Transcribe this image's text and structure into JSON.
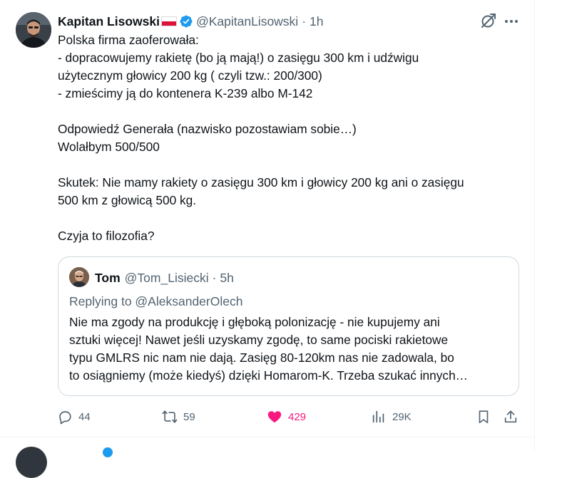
{
  "tweet": {
    "author_name": "Kapitan Lisowski",
    "author_handle": "@KapitanLisowski",
    "separator": "·",
    "time": "1h",
    "lines": [
      "Polska firma zaoferowała:",
      "- dopracowujemy rakietę (bo ją mają!)  o zasięgu 300 km i udźwigu",
      "użytecznym głowicy 200 kg  ( czyli tzw.: 200/300)",
      "- zmieścimy ją do kontenera K-239 albo M-142",
      "",
      "Odpowiedź Generała (nazwisko pozostawiam sobie…)",
      "Wolałbym 500/500",
      "",
      "Skutek: Nie mamy rakiety o zasięgu 300 km  i głowicy 200 kg ani o zasięgu",
      "500 km z głowicą 500 kg.",
      "",
      "Czyja to filozofia?"
    ]
  },
  "quote": {
    "author_name": "Tom",
    "author_handle": "@Tom_Lisiecki",
    "separator": "·",
    "time": "5h",
    "replying_to_prefix": "Replying to ",
    "replying_to_handle": "@AleksanderOlech",
    "lines": [
      "Nie ma zgody na produkcję i głęboką polonizację - nie kupujemy ani",
      "sztuki więcej! Nawet jeśli uzyskamy zgodę, to same pociski rakietowe",
      "typu GMLRS nic nam nie dają. Zasięg 80-120km nas nie zadowala, bo",
      "to osiągniemy (może kiedyś) dzięki Homarom-K. Trzeba szukać innych…"
    ]
  },
  "actions": {
    "replies": "44",
    "reposts": "59",
    "likes": "429",
    "views": "29K"
  },
  "colors": {
    "accent": "#1d9bf0",
    "like": "#f91880",
    "secondary_text": "#536471",
    "border": "#cfd9de"
  },
  "icons": {
    "verified": "verified-badge-icon",
    "grok": "grok-icon",
    "more": "more-icon",
    "reply": "reply-icon",
    "repost": "repost-icon",
    "like": "heart-filled-icon",
    "views": "views-icon",
    "bookmark": "bookmark-icon",
    "share": "share-icon"
  }
}
